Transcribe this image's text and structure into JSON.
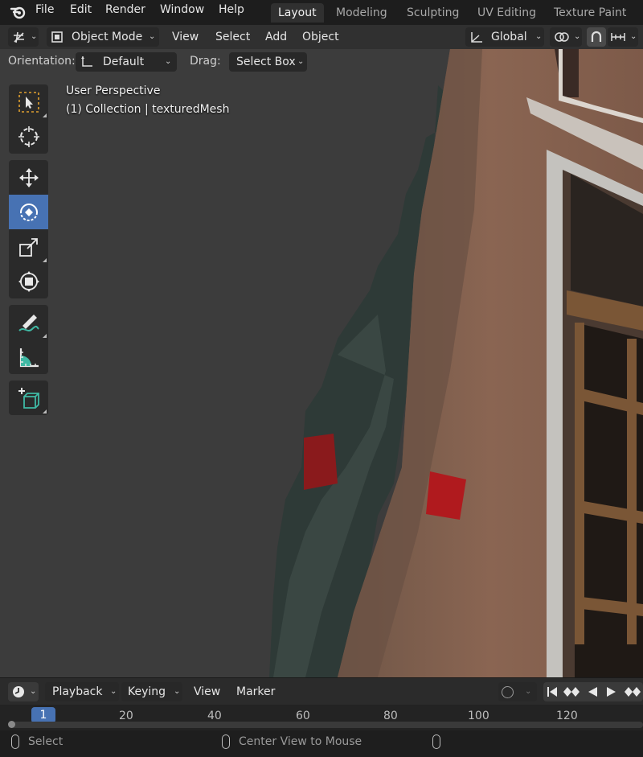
{
  "menu": {
    "items": [
      "File",
      "Edit",
      "Render",
      "Window",
      "Help"
    ]
  },
  "workspaces": {
    "tabs": [
      "Layout",
      "Modeling",
      "Sculpting",
      "UV Editing",
      "Texture Paint"
    ],
    "active": "Layout"
  },
  "header": {
    "mode": "Object Mode",
    "menus": [
      "View",
      "Select",
      "Add",
      "Object"
    ],
    "transform_orientation": "Global"
  },
  "tool_settings": {
    "orientation_label": "Orientation:",
    "orientation_value": "Default",
    "drag_label": "Drag:",
    "drag_value": "Select Box"
  },
  "viewport": {
    "perspective": "User Perspective",
    "collection": "(1) Collection | texturedMesh"
  },
  "toolbar": {
    "tools": [
      "select-box-icon",
      "cursor-icon",
      "move-icon",
      "rotate-icon",
      "scale-icon",
      "transform-icon",
      "annotate-icon",
      "measure-icon",
      "add-cube-icon"
    ],
    "active": "rotate-icon"
  },
  "timeline": {
    "menus": [
      "Playback",
      "Keying",
      "View",
      "Marker"
    ],
    "current_frame": "1",
    "ticks": [
      "20",
      "40",
      "60",
      "80",
      "100",
      "120"
    ]
  },
  "status_bar": {
    "left": "Select",
    "middle": "Center View to Mouse"
  },
  "colors": {
    "accent": "#4772b3",
    "wall": "#8a6552",
    "background": "#3c3c3c"
  }
}
